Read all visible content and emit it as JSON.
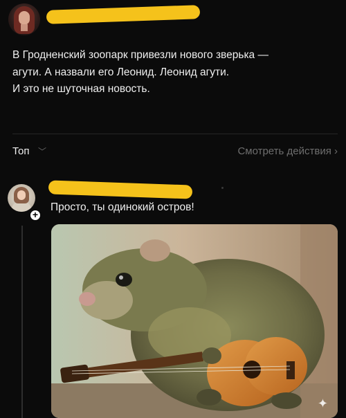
{
  "post": {
    "text_lines": [
      "В Гродненский зоопарк привезли нового зверька —",
      "агути. А назвали его Леонид. Леонид агути.",
      "И это не шуточная новость."
    ]
  },
  "comments_header": {
    "sort_label": "Топ",
    "activity_link": "Смотреть действия"
  },
  "comment": {
    "text": "Просто, ты одинокий остров!",
    "image_icon": "sparkle-icon"
  },
  "colors": {
    "background": "#0b0b0b",
    "redaction_bar": "#f5c21b",
    "muted_text": "#6e6e6e"
  }
}
